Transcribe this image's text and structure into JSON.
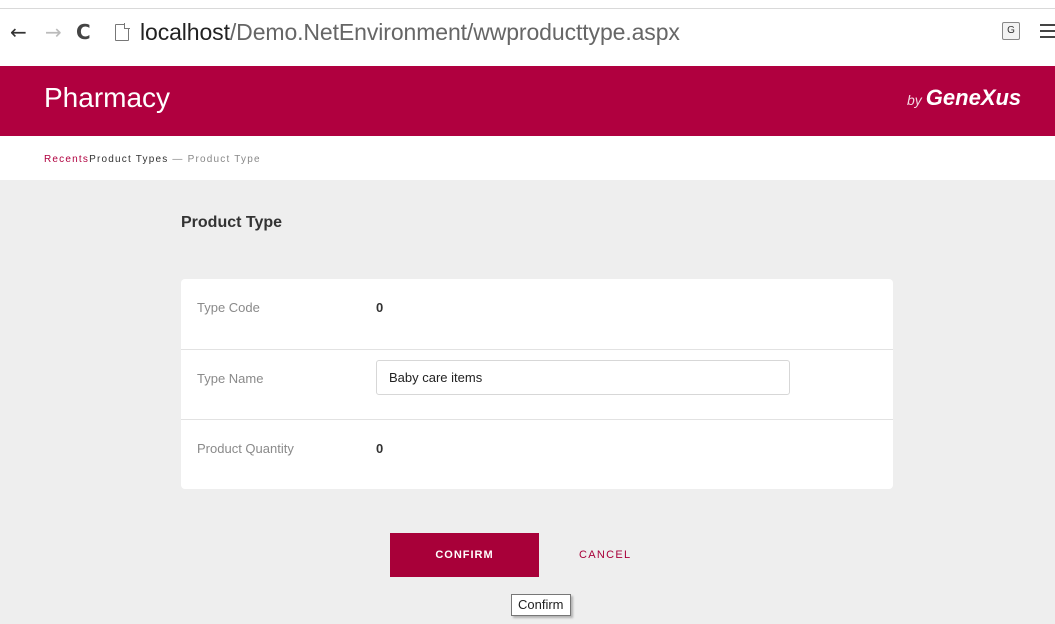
{
  "browser": {
    "url_host": "localhost",
    "url_path": "/Demo.NetEnvironment/wwproducttype.aspx",
    "back_icon": "←",
    "forward_icon": "→",
    "reload_icon": "C",
    "translate_icon": "G"
  },
  "header": {
    "title": "Pharmacy",
    "brand_by": "by",
    "brand_name": "GeneXus"
  },
  "breadcrumb": {
    "recents": "Recents",
    "parent": "Product Types",
    "separator": " — ",
    "current": "Product Type"
  },
  "form": {
    "title": "Product Type",
    "fields": [
      {
        "label": "Type Code",
        "value": "0"
      },
      {
        "label": "Type Name",
        "value": "Baby care items"
      },
      {
        "label": "Product Quantity",
        "value": "0"
      }
    ]
  },
  "actions": {
    "confirm": "CONFIRM",
    "cancel": "CANCEL"
  },
  "tooltip": "Confirm",
  "colors": {
    "accent": "#b0003f",
    "button": "#a80039",
    "background": "#eeeeee"
  }
}
